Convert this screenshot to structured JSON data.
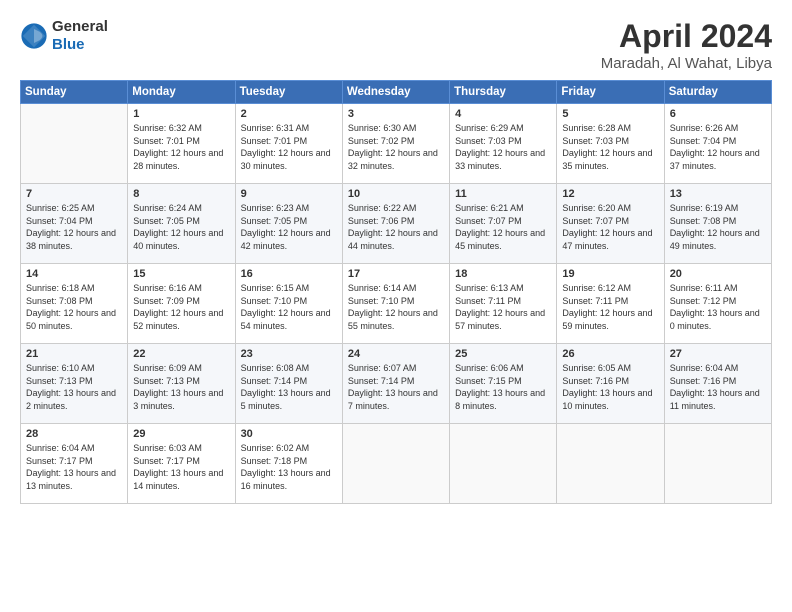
{
  "header": {
    "logo_general": "General",
    "logo_blue": "Blue",
    "title": "April 2024",
    "location": "Maradah, Al Wahat, Libya"
  },
  "days_of_week": [
    "Sunday",
    "Monday",
    "Tuesday",
    "Wednesday",
    "Thursday",
    "Friday",
    "Saturday"
  ],
  "weeks": [
    [
      {
        "day": "",
        "sunrise": "",
        "sunset": "",
        "daylight": ""
      },
      {
        "day": "1",
        "sunrise": "6:32 AM",
        "sunset": "7:01 PM",
        "daylight": "12 hours and 28 minutes."
      },
      {
        "day": "2",
        "sunrise": "6:31 AM",
        "sunset": "7:01 PM",
        "daylight": "12 hours and 30 minutes."
      },
      {
        "day": "3",
        "sunrise": "6:30 AM",
        "sunset": "7:02 PM",
        "daylight": "12 hours and 32 minutes."
      },
      {
        "day": "4",
        "sunrise": "6:29 AM",
        "sunset": "7:03 PM",
        "daylight": "12 hours and 33 minutes."
      },
      {
        "day": "5",
        "sunrise": "6:28 AM",
        "sunset": "7:03 PM",
        "daylight": "12 hours and 35 minutes."
      },
      {
        "day": "6",
        "sunrise": "6:26 AM",
        "sunset": "7:04 PM",
        "daylight": "12 hours and 37 minutes."
      }
    ],
    [
      {
        "day": "7",
        "sunrise": "6:25 AM",
        "sunset": "7:04 PM",
        "daylight": "12 hours and 38 minutes."
      },
      {
        "day": "8",
        "sunrise": "6:24 AM",
        "sunset": "7:05 PM",
        "daylight": "12 hours and 40 minutes."
      },
      {
        "day": "9",
        "sunrise": "6:23 AM",
        "sunset": "7:05 PM",
        "daylight": "12 hours and 42 minutes."
      },
      {
        "day": "10",
        "sunrise": "6:22 AM",
        "sunset": "7:06 PM",
        "daylight": "12 hours and 44 minutes."
      },
      {
        "day": "11",
        "sunrise": "6:21 AM",
        "sunset": "7:07 PM",
        "daylight": "12 hours and 45 minutes."
      },
      {
        "day": "12",
        "sunrise": "6:20 AM",
        "sunset": "7:07 PM",
        "daylight": "12 hours and 47 minutes."
      },
      {
        "day": "13",
        "sunrise": "6:19 AM",
        "sunset": "7:08 PM",
        "daylight": "12 hours and 49 minutes."
      }
    ],
    [
      {
        "day": "14",
        "sunrise": "6:18 AM",
        "sunset": "7:08 PM",
        "daylight": "12 hours and 50 minutes."
      },
      {
        "day": "15",
        "sunrise": "6:16 AM",
        "sunset": "7:09 PM",
        "daylight": "12 hours and 52 minutes."
      },
      {
        "day": "16",
        "sunrise": "6:15 AM",
        "sunset": "7:10 PM",
        "daylight": "12 hours and 54 minutes."
      },
      {
        "day": "17",
        "sunrise": "6:14 AM",
        "sunset": "7:10 PM",
        "daylight": "12 hours and 55 minutes."
      },
      {
        "day": "18",
        "sunrise": "6:13 AM",
        "sunset": "7:11 PM",
        "daylight": "12 hours and 57 minutes."
      },
      {
        "day": "19",
        "sunrise": "6:12 AM",
        "sunset": "7:11 PM",
        "daylight": "12 hours and 59 minutes."
      },
      {
        "day": "20",
        "sunrise": "6:11 AM",
        "sunset": "7:12 PM",
        "daylight": "13 hours and 0 minutes."
      }
    ],
    [
      {
        "day": "21",
        "sunrise": "6:10 AM",
        "sunset": "7:13 PM",
        "daylight": "13 hours and 2 minutes."
      },
      {
        "day": "22",
        "sunrise": "6:09 AM",
        "sunset": "7:13 PM",
        "daylight": "13 hours and 3 minutes."
      },
      {
        "day": "23",
        "sunrise": "6:08 AM",
        "sunset": "7:14 PM",
        "daylight": "13 hours and 5 minutes."
      },
      {
        "day": "24",
        "sunrise": "6:07 AM",
        "sunset": "7:14 PM",
        "daylight": "13 hours and 7 minutes."
      },
      {
        "day": "25",
        "sunrise": "6:06 AM",
        "sunset": "7:15 PM",
        "daylight": "13 hours and 8 minutes."
      },
      {
        "day": "26",
        "sunrise": "6:05 AM",
        "sunset": "7:16 PM",
        "daylight": "13 hours and 10 minutes."
      },
      {
        "day": "27",
        "sunrise": "6:04 AM",
        "sunset": "7:16 PM",
        "daylight": "13 hours and 11 minutes."
      }
    ],
    [
      {
        "day": "28",
        "sunrise": "6:04 AM",
        "sunset": "7:17 PM",
        "daylight": "13 hours and 13 minutes."
      },
      {
        "day": "29",
        "sunrise": "6:03 AM",
        "sunset": "7:17 PM",
        "daylight": "13 hours and 14 minutes."
      },
      {
        "day": "30",
        "sunrise": "6:02 AM",
        "sunset": "7:18 PM",
        "daylight": "13 hours and 16 minutes."
      },
      {
        "day": "",
        "sunrise": "",
        "sunset": "",
        "daylight": ""
      },
      {
        "day": "",
        "sunrise": "",
        "sunset": "",
        "daylight": ""
      },
      {
        "day": "",
        "sunrise": "",
        "sunset": "",
        "daylight": ""
      },
      {
        "day": "",
        "sunrise": "",
        "sunset": "",
        "daylight": ""
      }
    ]
  ],
  "labels": {
    "sunrise_prefix": "Sunrise: ",
    "sunset_prefix": "Sunset: ",
    "daylight_prefix": "Daylight: "
  }
}
